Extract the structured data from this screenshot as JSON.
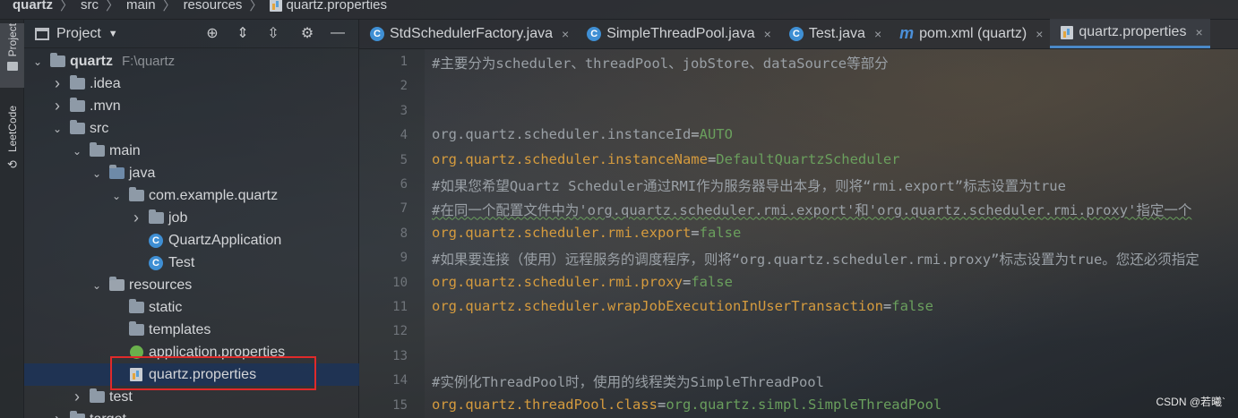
{
  "breadcrumb": [
    "quartz",
    "src",
    "main",
    "resources",
    "quartz.properties"
  ],
  "strip": {
    "project": "Project",
    "leetcode": "LeetCode"
  },
  "panel": {
    "title": "Project"
  },
  "tree": [
    {
      "label": "quartz",
      "hint": "F:\\quartz",
      "depth": 0,
      "arrow": "down",
      "icon": "module"
    },
    {
      "label": ".idea",
      "depth": 1,
      "arrow": "right",
      "icon": "folder"
    },
    {
      "label": ".mvn",
      "depth": 1,
      "arrow": "right",
      "icon": "folder"
    },
    {
      "label": "src",
      "depth": 1,
      "arrow": "down",
      "icon": "folder"
    },
    {
      "label": "main",
      "depth": 2,
      "arrow": "down",
      "icon": "folder"
    },
    {
      "label": "java",
      "depth": 3,
      "arrow": "down",
      "icon": "folder-src"
    },
    {
      "label": "com.example.quartz",
      "depth": 4,
      "arrow": "down",
      "icon": "package"
    },
    {
      "label": "job",
      "depth": 5,
      "arrow": "right",
      "icon": "package"
    },
    {
      "label": "QuartzApplication",
      "depth": 5,
      "arrow": "",
      "icon": "class"
    },
    {
      "label": "Test",
      "depth": 5,
      "arrow": "",
      "icon": "class"
    },
    {
      "label": "resources",
      "depth": 3,
      "arrow": "down",
      "icon": "folder-res"
    },
    {
      "label": "static",
      "depth": 4,
      "arrow": "",
      "icon": "folder"
    },
    {
      "label": "templates",
      "depth": 4,
      "arrow": "",
      "icon": "folder"
    },
    {
      "label": "application.properties",
      "depth": 4,
      "arrow": "",
      "icon": "spring"
    },
    {
      "label": "quartz.properties",
      "depth": 4,
      "arrow": "",
      "icon": "props",
      "selected": true
    },
    {
      "label": "test",
      "depth": 2,
      "arrow": "right",
      "icon": "folder"
    },
    {
      "label": "target",
      "depth": 1,
      "arrow": "right",
      "icon": "folder"
    }
  ],
  "tabs": [
    {
      "label": "StdSchedulerFactory.java",
      "icon": "class"
    },
    {
      "label": "SimpleThreadPool.java",
      "icon": "class"
    },
    {
      "label": "Test.java",
      "icon": "class"
    },
    {
      "label": "pom.xml (quartz)",
      "icon": "maven"
    },
    {
      "label": "quartz.properties",
      "icon": "props",
      "active": true
    }
  ],
  "editor": {
    "lines": [
      {
        "n": "1",
        "parts": [
          {
            "t": "#主要分为scheduler、threadPool、jobStore、dataSource等部分",
            "c": "cm"
          }
        ]
      },
      {
        "n": "2",
        "parts": []
      },
      {
        "n": "3",
        "parts": []
      },
      {
        "n": "4",
        "parts": [
          {
            "t": "org.quartz.scheduler.instanceId",
            "c": "key dim"
          },
          {
            "t": "=",
            "c": "eq"
          },
          {
            "t": "AUTO",
            "c": "val"
          }
        ]
      },
      {
        "n": "5",
        "parts": [
          {
            "t": "org.quartz.scheduler.instanceName",
            "c": "key"
          },
          {
            "t": "=",
            "c": "eq"
          },
          {
            "t": "DefaultQuartzScheduler",
            "c": "val"
          }
        ]
      },
      {
        "n": "6",
        "parts": [
          {
            "t": "#如果您希望Quartz Scheduler通过RMI作为服务器导出本身，则将“rmi.export”标志设置为true",
            "c": "cm"
          }
        ]
      },
      {
        "n": "7",
        "parts": [
          {
            "t": "#在同一个配置文件中为'org.quartz.scheduler.rmi.export'和'org.quartz.scheduler.rmi.proxy'指定一个",
            "c": "cm squig"
          }
        ]
      },
      {
        "n": "8",
        "parts": [
          {
            "t": "org.quartz.scheduler.rmi.export",
            "c": "key"
          },
          {
            "t": "=",
            "c": "eq"
          },
          {
            "t": "false",
            "c": "val"
          }
        ]
      },
      {
        "n": "9",
        "parts": [
          {
            "t": "#如果要连接（使用）远程服务的调度程序，则将“org.quartz.scheduler.rmi.proxy”标志设置为true。您还必须指定",
            "c": "cm"
          }
        ]
      },
      {
        "n": "10",
        "parts": [
          {
            "t": "org.quartz.scheduler.rmi.proxy",
            "c": "key"
          },
          {
            "t": "=",
            "c": "eq"
          },
          {
            "t": "false",
            "c": "val"
          }
        ]
      },
      {
        "n": "11",
        "parts": [
          {
            "t": "org.quartz.scheduler.wrapJobExecutionInUserTransaction",
            "c": "key"
          },
          {
            "t": "=",
            "c": "eq"
          },
          {
            "t": "false",
            "c": "val"
          }
        ]
      },
      {
        "n": "12",
        "parts": []
      },
      {
        "n": "13",
        "parts": []
      },
      {
        "n": "14",
        "parts": [
          {
            "t": "#实例化ThreadPool时，使用的线程类为SimpleThreadPool",
            "c": "cm"
          }
        ]
      },
      {
        "n": "15",
        "parts": [
          {
            "t": "org.quartz.threadPool.class",
            "c": "key"
          },
          {
            "t": "=",
            "c": "eq"
          },
          {
            "t": "org.quartz.simpl.SimpleThreadPool",
            "c": "val"
          }
        ]
      }
    ]
  },
  "watermark": "CSDN @若曦`"
}
